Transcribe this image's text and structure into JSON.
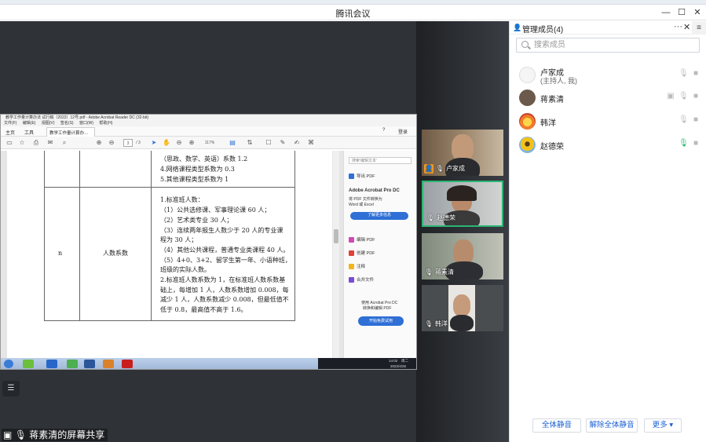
{
  "window": {
    "title": "腾讯会议",
    "minimize": "—",
    "maximize": "☐",
    "close": "✕"
  },
  "shared_screen": {
    "app_title": "教学工作量计算办法 试行稿（2022）12号.pdf - Adobe Acrobat Reader DC (32-bit)",
    "menu": [
      "文件(F)",
      "编辑(E)",
      "视图(V)",
      "签名(S)",
      "窗口(W)",
      "帮助(H)"
    ],
    "tabs": {
      "home": "主页",
      "tools": "工具",
      "doc_tab": "教学工作量计算办…",
      "signin": "登录"
    },
    "page_indicator": "3",
    "page_total": "/ 3",
    "zoom": "117%",
    "document": {
      "top_lines": [
        "（思政、数学、英语）系数 1.2",
        "4.网络课程类型系数为 0.3",
        "5.其他课程类型系数为 1"
      ],
      "row_label_n": "n",
      "row_label_name": "人数系数",
      "body_lines": [
        "1.标准班人数：",
        "（1）公共选修课、军事理论课 60 人；",
        "（2）艺术类专业 30 人；",
        "（3）连续两年报生人数少于 20 人的专业课",
        "程为 30 人；",
        "（4）其他公共课程，普通专业类课程 40 人。",
        "（5）4+0、3+2、留学生第一年、小语种班，",
        "班级的实际人数。",
        "2.标准班人数系数为 1，在标准班人数系数基",
        "础上，每增加 1 人，人数系数增加 0.008，每",
        "减少 1 人，人数系数减少 0.008，但最低值不",
        "低于 0.8，最高值不高于 1.6。"
      ]
    },
    "sidebar": {
      "search_placeholder": "搜索'编辑文本'",
      "export_pdf": "导出 PDF",
      "product_title": "Adobe Acrobat Pro DC",
      "product_desc_1": "将 PDF 文件转换为",
      "product_desc_2": "Word 或 Excel",
      "learn_more": "了解更多信息",
      "edit_pdf": "编辑 PDF",
      "create_pdf": "创建 PDF",
      "comment": "注释",
      "combine": "合并文件",
      "promo_1": "使用 Acrobat Pro DC",
      "promo_2": "转换和编辑 PDF",
      "trial": "开始免费试用"
    },
    "tray": {
      "time": "14:02",
      "day": "周二",
      "date": "2022/4/26"
    }
  },
  "videos": [
    {
      "name": "卢家成",
      "host": true
    },
    {
      "name": "赵德荣",
      "host": false
    },
    {
      "name": "蒋素清",
      "host": false
    },
    {
      "name": "韩洋",
      "host": false
    }
  ],
  "screen_share_label": "蒋素清的屏幕共享",
  "panel": {
    "title": "管理成员(4)",
    "more": "···",
    "close": "✕",
    "side_menu": "≡",
    "search_placeholder": "搜索成员",
    "members": [
      {
        "name": "卢家成",
        "role": "(主持人, 我)"
      },
      {
        "name": "蒋素清",
        "role": ""
      },
      {
        "name": "韩洋",
        "role": ""
      },
      {
        "name": "赵德荣",
        "role": ""
      }
    ],
    "buttons": {
      "mute_all": "全体静音",
      "unmute_all": "解除全体静音",
      "more": "更多 ▾"
    }
  },
  "colors": {
    "accent": "#1a5fd3",
    "active_speaker": "#2bb673",
    "host_badge": "#f39c2b",
    "stage": "#2f3338"
  }
}
